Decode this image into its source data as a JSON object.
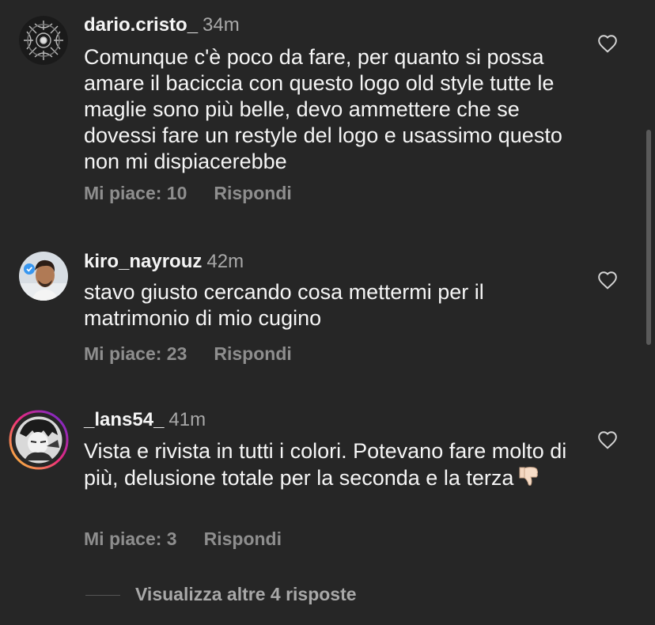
{
  "comments": [
    {
      "username": "dario.cristo_",
      "time": "34m",
      "text": "Comunque c'è poco da fare, per quanto si possa amare il baciccia con questo logo old style tutte le maglie sono più belle, devo ammettere che se dovessi fare un restyle del logo e usassimo questo non mi dispiacerebbe",
      "likes": "Mi piace: 10",
      "reply": "Rispondi",
      "avatar_icon": "dark-ornament-avatar"
    },
    {
      "username": "kiro_nayrouz",
      "time": "42m",
      "text": "stavo giusto cercando cosa mettermi per il matrimonio di mio cugino",
      "likes": "Mi piace: 23",
      "reply": "Rispondi",
      "avatar_icon": "portrait-avatar"
    },
    {
      "username": "_lans54_",
      "time": "41m",
      "text": "Vista e rivista in tutti i colori. Potevano fare molto di più, delusione totale per la seconda e la terza",
      "emoji": "👎🏻",
      "likes": "Mi piace: 3",
      "reply": "Rispondi",
      "avatar_icon": "anime-avatar-with-story-ring"
    }
  ],
  "view_more": "Visualizza altre 4 risposte",
  "colors": {
    "background": "#262626",
    "text": "#f5f5f5",
    "muted": "#8e8e8e",
    "story_ring": [
      "#f9ce34",
      "#ee2a7b",
      "#6228d7"
    ]
  }
}
